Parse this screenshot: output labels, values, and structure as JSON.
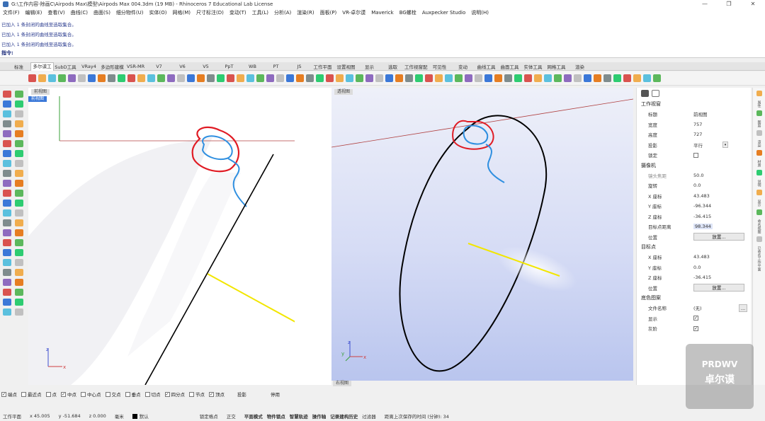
{
  "window": {
    "title": "G:\\工作内容-除画C\\Airpods Max\\模型\\Airpods Max 004.3dm (19 MB) - Rhinoceros 7 Educational Lab License",
    "controls": [
      "—",
      "❐",
      "✕"
    ]
  },
  "menu": [
    "文件(F)",
    "编辑(E)",
    "查看(V)",
    "曲线(C)",
    "曲面(S)",
    "细分物件(U)",
    "实体(O)",
    "网格(M)",
    "尺寸标注(D)",
    "变动(T)",
    "工具(L)",
    "分析(A)",
    "渲染(R)",
    "面板(P)",
    "VR-卓尔谟",
    "Maverick",
    "BG螺栓",
    "Auxpecker Studio",
    "说明(H)"
  ],
  "command_history": {
    "lines": [
      "已加入 1 条封闭的曲线至选取集合。",
      "已加入 1 条封闭的曲线至选取集合。",
      "已加入 1 条封闭的曲线至选取集合。"
    ],
    "prompt": "指令:"
  },
  "tabs": [
    "标准",
    "多尔谟工",
    "SubD工具",
    "VRay4",
    "多边形建模",
    "VSR-MR",
    "V7",
    "V6",
    "V5",
    "PpT",
    "WB",
    "PT",
    "JS",
    "工作平面",
    "设置视图",
    "显示",
    "选取",
    "工作视窗配置",
    "可见性",
    "变动",
    "曲线工具",
    "曲面工具",
    "实体工具",
    "网格工具",
    "渲染"
  ],
  "active_tab_index": 1,
  "viewports": {
    "left_tab": "前视图",
    "left_tab2": "前视图",
    "right_tab": "透视图",
    "right_bottom_tab": "右视图"
  },
  "axes": {
    "x": "x",
    "y": "y",
    "z": "z"
  },
  "properties": {
    "section_viewport": "工作视窗",
    "title_label": "标题",
    "title_value": "前视图",
    "width_label": "宽度",
    "width_value": "757",
    "height_label": "高度",
    "height_value": "727",
    "projection_label": "投影",
    "projection_value": "平行",
    "lock_label": "锁定",
    "section_camera": "摄像机",
    "lens_label": "镜头焦距",
    "lens_value": "50.0",
    "rotation_label": "旋转",
    "rotation_value": "0.0",
    "cx_label": "X 座标",
    "cx_value": "43.483",
    "cy_label": "Y 座标",
    "cy_value": "-96.344",
    "cz_label": "Z 座标",
    "cz_value": "-36.415",
    "target_dist_label": "目标点距离",
    "target_dist_value": "98.344",
    "position_label": "位置",
    "place_button": "放置...",
    "section_target": "目标点",
    "tx_label": "X 座标",
    "tx_value": "43.483",
    "ty_label": "Y 座标",
    "ty_value": "0.0",
    "tz_label": "Z 座标",
    "tz_value": "-36.415",
    "tposition_label": "位置",
    "tplace_button": "放置...",
    "section_wallpaper": "底色图案",
    "filename_label": "文件名称",
    "filename_value": "(无)",
    "browse_button": "...",
    "show_label": "显示",
    "gray_label": "灰阶"
  },
  "right_strip": [
    "属性",
    "图层",
    "渲染",
    "材质",
    "说明",
    "显示",
    "命名视图",
    "已命名工作平面"
  ],
  "osnaps": [
    {
      "label": "端点",
      "checked": true
    },
    {
      "label": "最近点",
      "checked": false
    },
    {
      "label": "点",
      "checked": false
    },
    {
      "label": "中点",
      "checked": true
    },
    {
      "label": "中心点",
      "checked": false
    },
    {
      "label": "交点",
      "checked": false
    },
    {
      "label": "垂点",
      "checked": false
    },
    {
      "label": "切点",
      "checked": false
    },
    {
      "label": "四分点",
      "checked": true
    },
    {
      "label": "节点",
      "checked": false
    },
    {
      "label": "顶点",
      "checked": true
    }
  ],
  "osnap_extra": [
    "投影",
    "停用"
  ],
  "status": {
    "cplane": "工作平面",
    "x": "x 45.005",
    "y": "y -51.684",
    "z": "z 0.000",
    "units": "毫米",
    "layer": "默认",
    "items": [
      "锁定格点",
      "正交",
      "平面模式",
      "物件锁点",
      "智慧轨迹",
      "操作轴",
      "记录建构历史",
      "过滤器",
      "距离上次保存的时间 (分钟): 34"
    ]
  },
  "watermark": {
    "line1": "PRDWV",
    "line2": "卓尔谟"
  },
  "colors": {
    "accent": "#3b78d8",
    "red_curve": "#e01b24",
    "blue_curve": "#2f8fe0",
    "yellow": "#f2e600"
  }
}
